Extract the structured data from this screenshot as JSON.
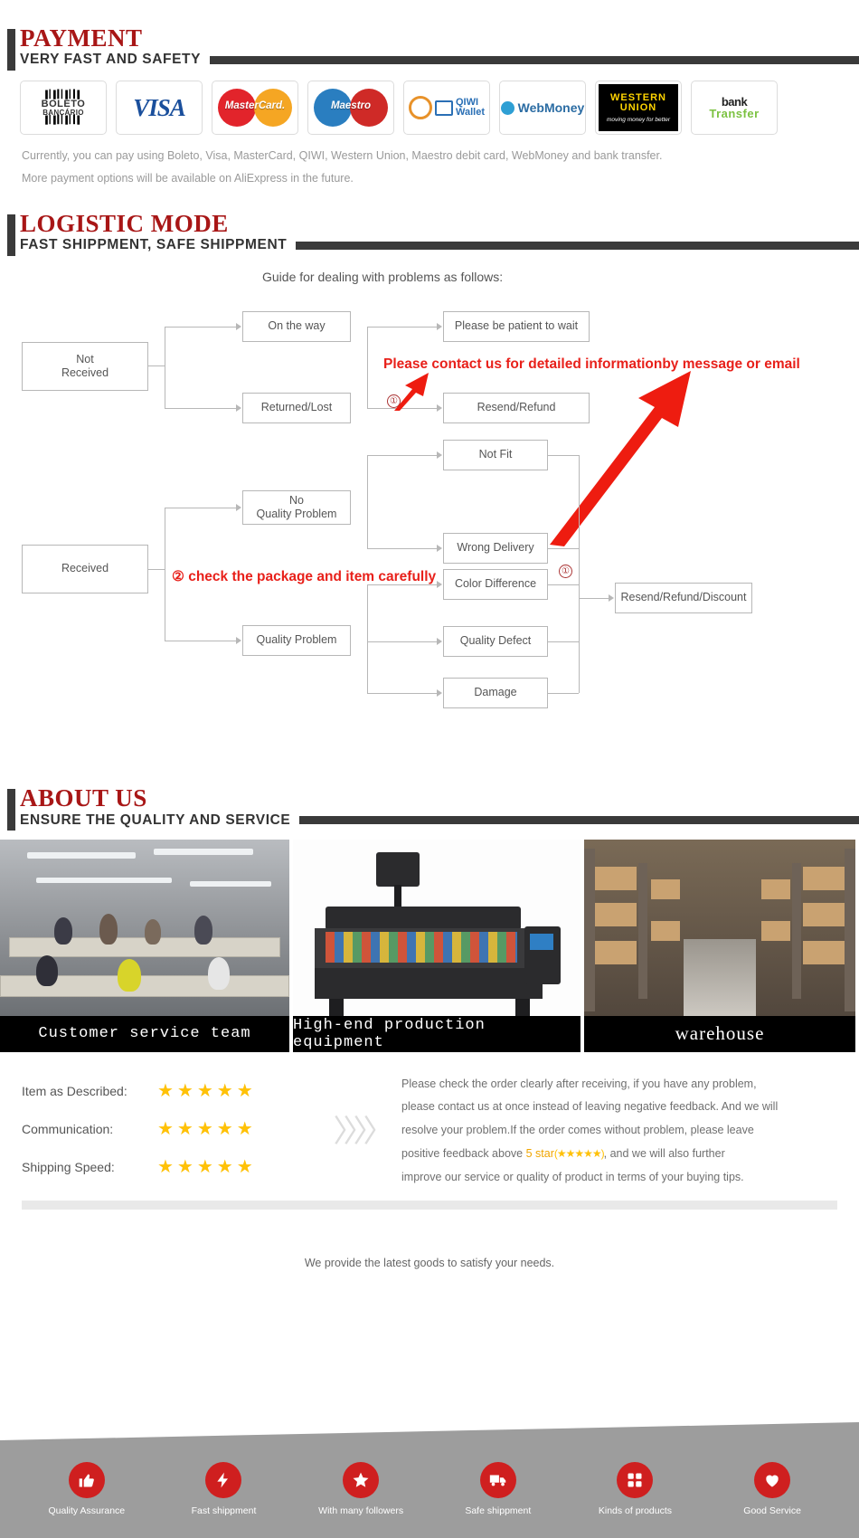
{
  "payment": {
    "title": "PAYMENT",
    "subtitle": "VERY FAST AND SAFETY",
    "logos": [
      {
        "name": "boleto-bancario-logo",
        "line1": "BOLETO",
        "line2": "BANCÁRIO"
      },
      {
        "name": "visa-logo",
        "text": "VISA"
      },
      {
        "name": "mastercard-logo",
        "text": "MasterCard."
      },
      {
        "name": "maestro-logo",
        "text": "Maestro"
      },
      {
        "name": "qiwi-wallet-logo",
        "line1": "QIWI",
        "line2": "Wallet"
      },
      {
        "name": "webmoney-logo",
        "text": "WebMoney"
      },
      {
        "name": "western-union-logo",
        "line1": "WESTERN",
        "line2": "UNION",
        "line3": "moving money for better"
      },
      {
        "name": "bank-transfer-logo",
        "line1": "bank",
        "line2": "Transfer"
      }
    ],
    "note_line1": "Currently, you can pay using Boleto, Visa, MasterCard, QIWI, Western Union, Maestro debit card, WebMoney and bank transfer.",
    "note_line2": "More payment options will be available on AliExpress in the future."
  },
  "logistic": {
    "title": "LOGISTIC MODE",
    "subtitle": "FAST SHIPPMENT, SAFE SHIPPMENT",
    "flow_title": "Guide for dealing with problems as follows:",
    "boxes": {
      "not_received": "Not\nReceived",
      "on_the_way": "On the way",
      "returned_lost": "Returned/Lost",
      "please_wait": "Please be patient to wait",
      "resend_refund": "Resend/Refund",
      "received": "Received",
      "no_quality_problem": "No\nQuality Problem",
      "quality_problem": "Quality Problem",
      "not_fit": "Not Fit",
      "wrong_delivery": "Wrong Delivery",
      "color_difference": "Color Difference",
      "quality_defect": "Quality Defect",
      "damage": "Damage",
      "resend_refund_discount": "Resend/Refund/Discount"
    },
    "annotations": {
      "note1": "Please contact us for detailed informationby message or email",
      "note2": "② check the package and item carefully",
      "marker1": "①",
      "marker2": "①"
    }
  },
  "about": {
    "title": "ABOUT US",
    "subtitle": "ENSURE THE QUALITY AND SERVICE",
    "photos": [
      {
        "caption": "Customer service team",
        "name": "photo-customer-service-team"
      },
      {
        "caption": "High-end production equipment",
        "name": "photo-production-equipment"
      },
      {
        "caption": "warehouse",
        "name": "photo-warehouse"
      }
    ]
  },
  "ratings": {
    "rows": [
      {
        "label": "Item as Described:",
        "stars": 5
      },
      {
        "label": "Communication:",
        "stars": 5
      },
      {
        "label": "Shipping Speed:",
        "stars": 5
      }
    ],
    "star_glyph": "★",
    "chevrons": "〉〉〉〉",
    "feedback": {
      "line1": "Please check the order clearly after receiving, if you have any problem,",
      "line2": "please contact us at once instead of leaving negative feedback. And we will",
      "line3": "resolve your problem.If the order comes without problem, please leave",
      "line4_pre": "positive feedback above ",
      "line4_highlight": "5 star",
      "line4_stars": "(★★★★★)",
      "line4_post": ", and we will also further",
      "line5": "improve our service or quality of product in terms of your buying tips."
    }
  },
  "tagline": "We provide the latest goods to satisfy your needs.",
  "features": [
    {
      "label": "Quality Assurance",
      "icon": "thumbs-up-icon",
      "glyph": "👍"
    },
    {
      "label": "Fast shippment",
      "icon": "lightning-bolt-icon",
      "glyph": "⚡"
    },
    {
      "label": "With many followers",
      "icon": "star-icon",
      "glyph": "★"
    },
    {
      "label": "Safe shippment",
      "icon": "truck-icon",
      "glyph": "🚚"
    },
    {
      "label": "Kinds of products",
      "icon": "grid-blocks-icon",
      "glyph": "▦"
    },
    {
      "label": "Good Service",
      "icon": "heart-icon",
      "glyph": "♥"
    }
  ],
  "colors": {
    "accent_red": "#a81616",
    "note_red": "#e8201a",
    "dark_bar": "#3a3a3a",
    "star_gold": "#ffc107",
    "feature_circle": "#cf1f1f"
  }
}
